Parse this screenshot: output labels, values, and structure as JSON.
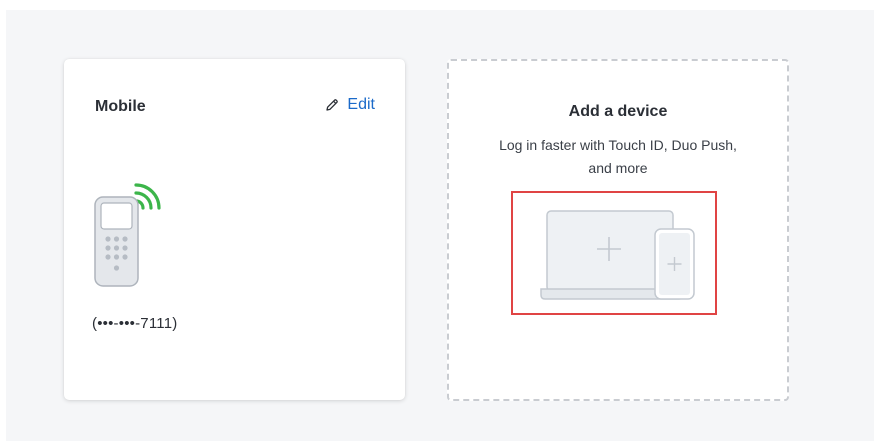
{
  "mobile_card": {
    "title": "Mobile",
    "edit_label": "Edit",
    "phone_number": "(•••-•••-7111)"
  },
  "add_device_card": {
    "title": "Add a device",
    "subtitle": "Log in faster with Touch ID, Duo Push, and more"
  },
  "icons": {
    "edit": "pencil-icon",
    "phone": "mobile-phone-icon",
    "signal": "wireless-signal-icon",
    "add_device": "laptop-and-phone-plus-icon"
  },
  "colors": {
    "link": "#1b6ac9",
    "signal": "#3cb54a",
    "highlight_border": "#e04444",
    "dashed_border": "#c9ccd1",
    "background": "#f5f6f8"
  }
}
